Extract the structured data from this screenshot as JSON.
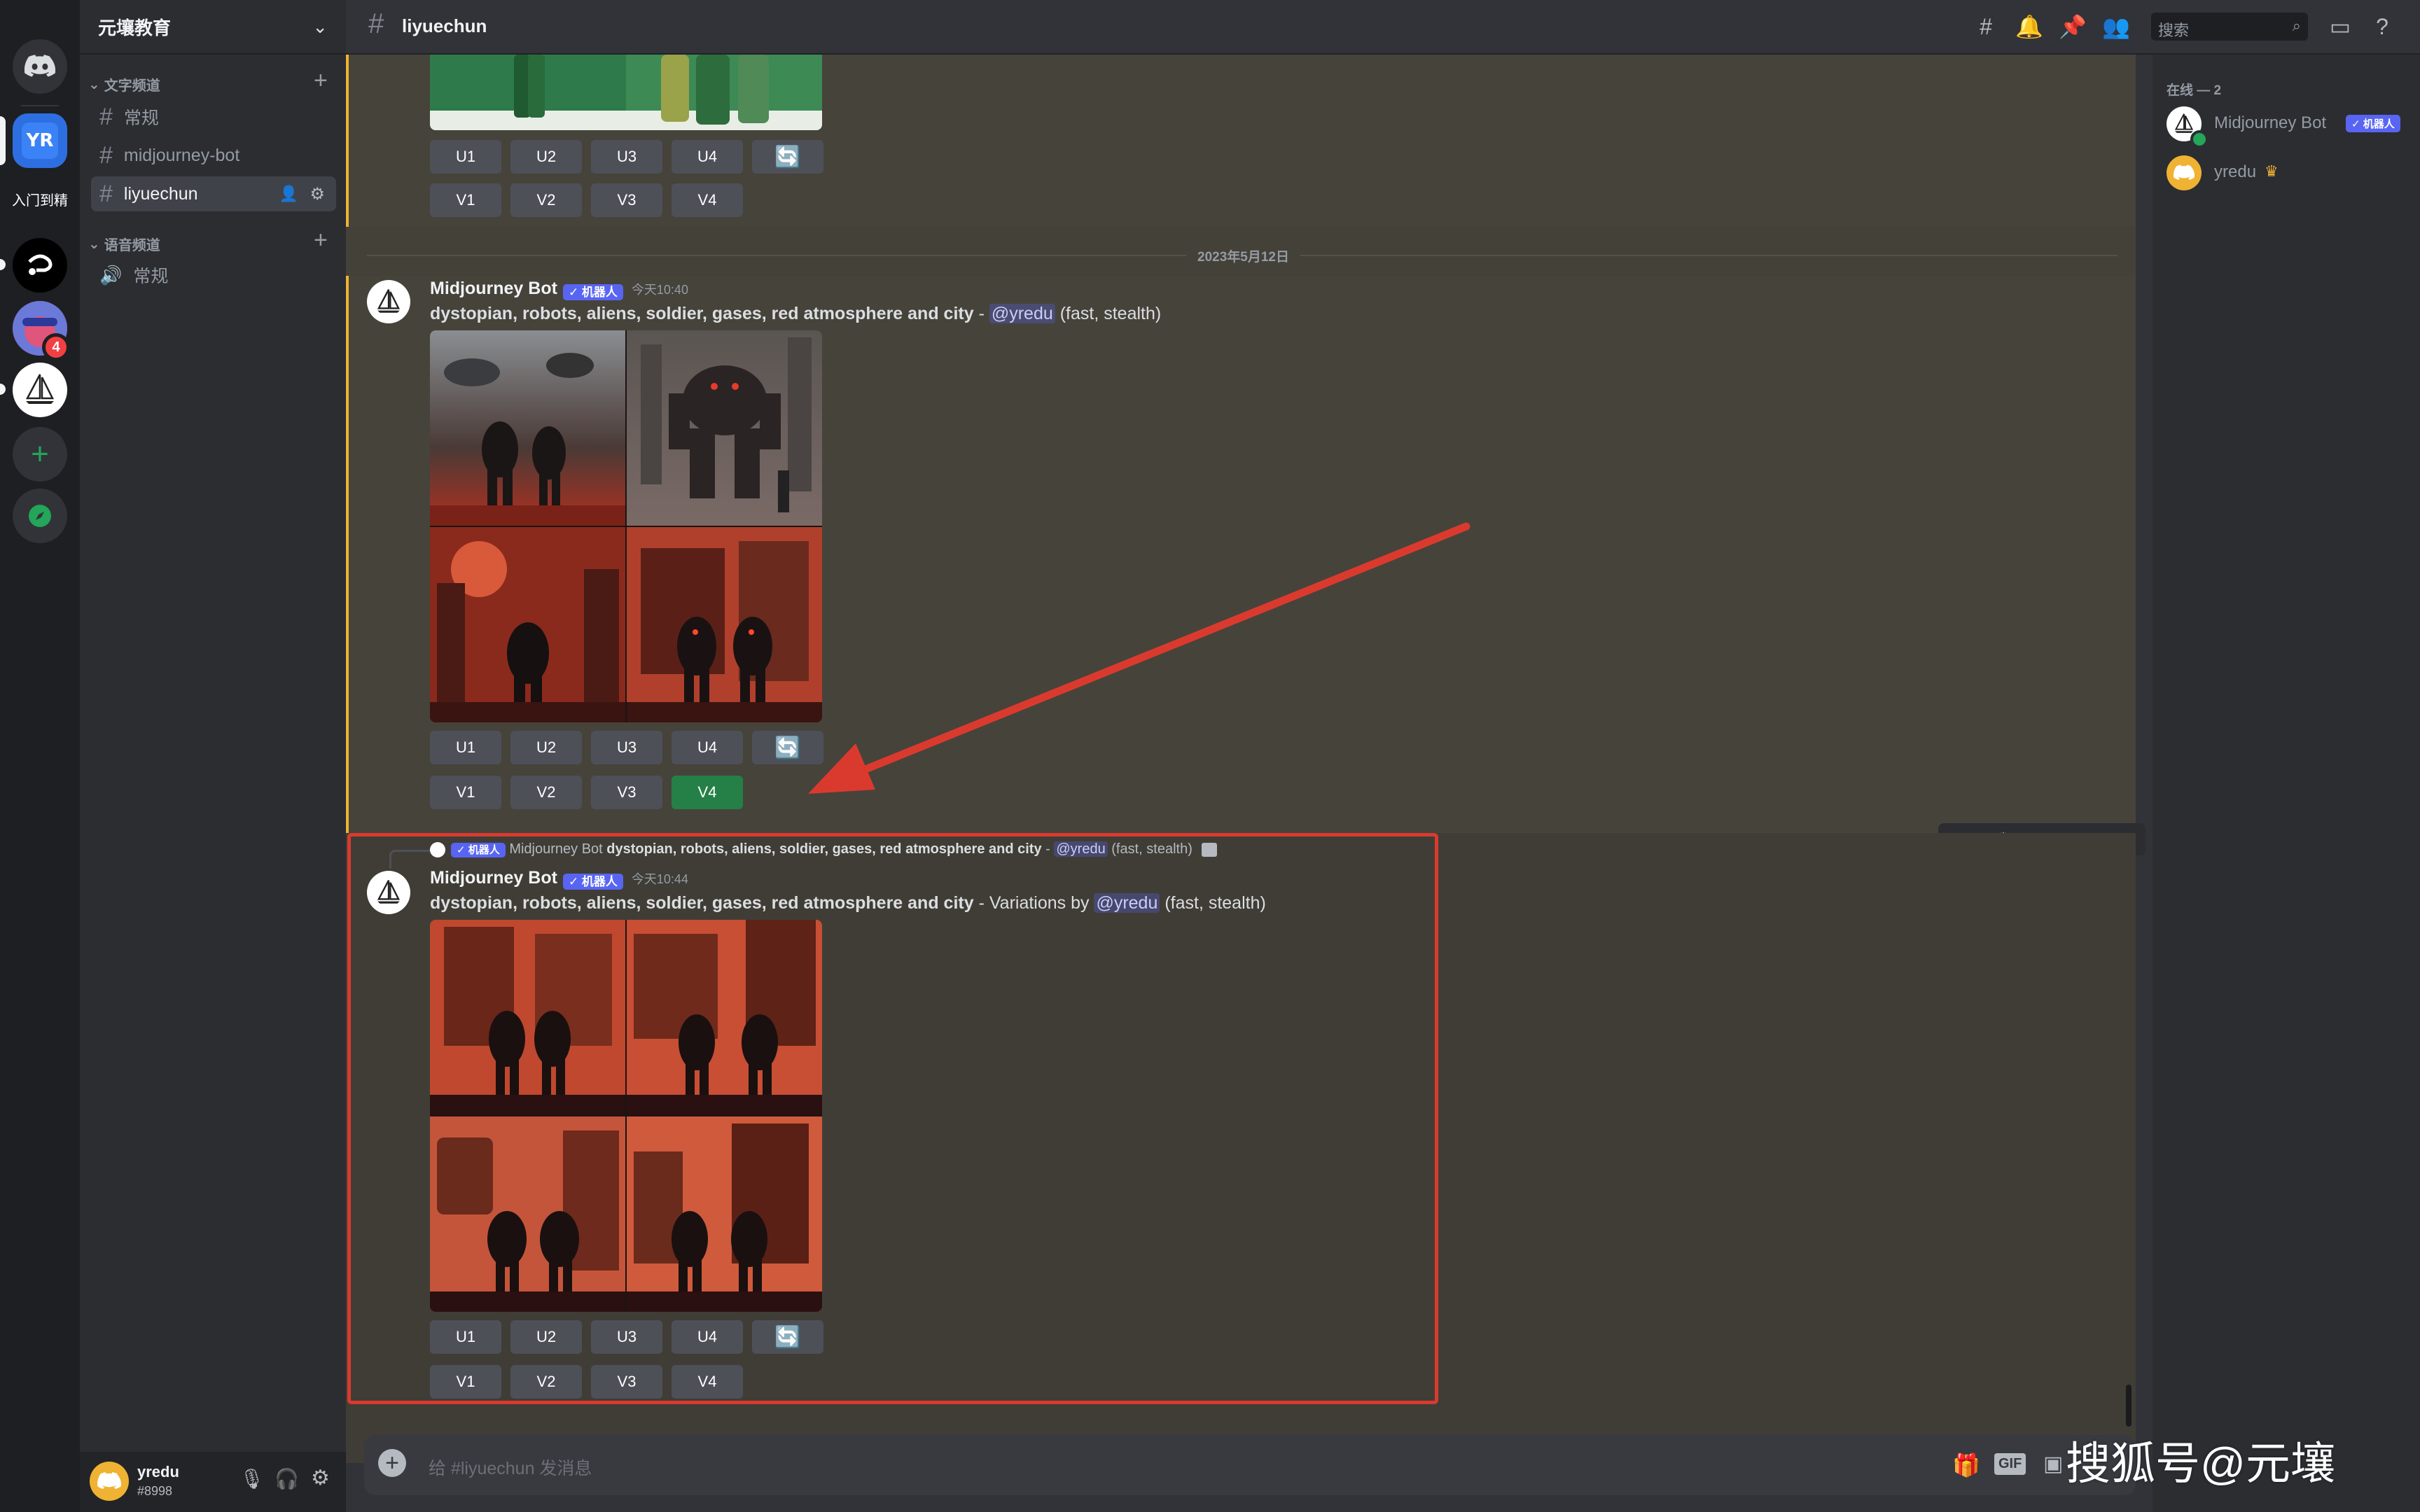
{
  "rail": {
    "server2_label": "入门到精",
    "notif_badge": "4"
  },
  "server": {
    "name": "元壤教育",
    "text_category": "文字频道",
    "voice_category": "语音频道",
    "channels": [
      "常规",
      "midjourney-bot",
      "liyuechun"
    ],
    "voice_channels": [
      "常规"
    ]
  },
  "user": {
    "name": "yredu",
    "tag": "#8998"
  },
  "topbar": {
    "channel": "liyuechun",
    "search_placeholder": "搜索"
  },
  "date_divider": "2023年5月12日",
  "messages": [
    {
      "author": "Midjourney Bot",
      "bot_badge": "✓ 机器人",
      "time": "今天10:40",
      "prompt": "dystopian, robots, aliens, soldier, gases, red atmosphere and city",
      "sep": " - ",
      "mention": "@yredu",
      "suffix": " (fast, stealth)"
    },
    {
      "author": "Midjourney Bot",
      "bot_badge": "✓ 机器人",
      "time": "今天10:44",
      "prompt": "dystopian, robots, aliens, soldier, gases, red atmosphere and city",
      "sep": " - Variations by ",
      "mention": "@yredu",
      "suffix": " (fast, stealth)",
      "reply_author": "Midjourney Bot",
      "reply_prompt": "dystopian, robots, aliens, soldier, gases, red atmosphere and city",
      "reply_sep": " - ",
      "reply_mention": "@yredu",
      "reply_suffix": " (fast, stealth)"
    }
  ],
  "buttons": {
    "u": [
      "U1",
      "U2",
      "U3",
      "U4"
    ],
    "v": [
      "V1",
      "V2",
      "V3",
      "V4"
    ],
    "refresh_icon": "refresh-icon"
  },
  "members": {
    "header": "在线 — 2",
    "list": [
      {
        "name": "Midjourney Bot",
        "badge": "✓ 机器人"
      },
      {
        "name": "yredu",
        "crown": "♛"
      }
    ]
  },
  "input_placeholder": "给 #liyuechun 发消息",
  "input_icons": {
    "gif": "GIF"
  },
  "watermark": "搜狐号@元壤",
  "colors": {
    "highlight": "#da3a2e",
    "accent": "#5865f2",
    "green": "#248046",
    "mention_bar": "#f0b232"
  }
}
